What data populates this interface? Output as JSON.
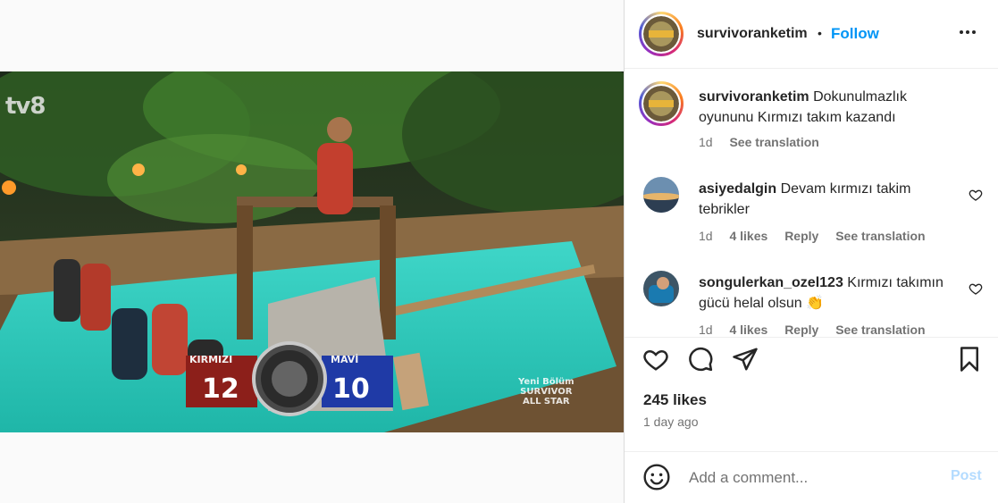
{
  "post": {
    "username": "survivoranketim",
    "separator": "•",
    "follow_label": "Follow",
    "more_icon": "more-horizontal-icon",
    "caption_text": "Dokunulmazlık oyununu Kırmızı takım kazandı",
    "caption_time": "1d",
    "caption_translate": "See translation"
  },
  "video": {
    "channel_logo": "tv8",
    "score_left_label": "KIRMIZI",
    "score_left_value": "12",
    "score_right_label": "MAVİ",
    "score_right_value": "10",
    "promo_line1": "Yeni Bölüm",
    "promo_line2": "SURVIVOR",
    "promo_line3": "ALL STAR"
  },
  "comments": [
    {
      "username": "asiyedalgin",
      "text": "Devam kırmızı takim tebrikler",
      "time": "1d",
      "likes": "4 likes",
      "reply": "Reply",
      "translate": "See translation"
    },
    {
      "username": "songulerkan_ozel123",
      "text": "Kırmızı takımın gücü helal olsun 👏",
      "time": "1d",
      "likes": "4 likes",
      "reply": "Reply",
      "translate": "See translation"
    }
  ],
  "actions": {
    "icons": [
      "heart-icon",
      "comment-icon",
      "share-icon",
      "bookmark-icon"
    ],
    "likes_count": "245 likes",
    "time_ago": "1 day ago"
  },
  "add_comment": {
    "emoji_icon": "emoji-icon",
    "placeholder": "Add a comment...",
    "post_label": "Post"
  },
  "colors": {
    "accent": "#0095f6",
    "post_disabled": "#b3dbff",
    "secondary_text": "#737373",
    "red_team": "#c0392b",
    "blue_team": "#1f3aa6"
  }
}
